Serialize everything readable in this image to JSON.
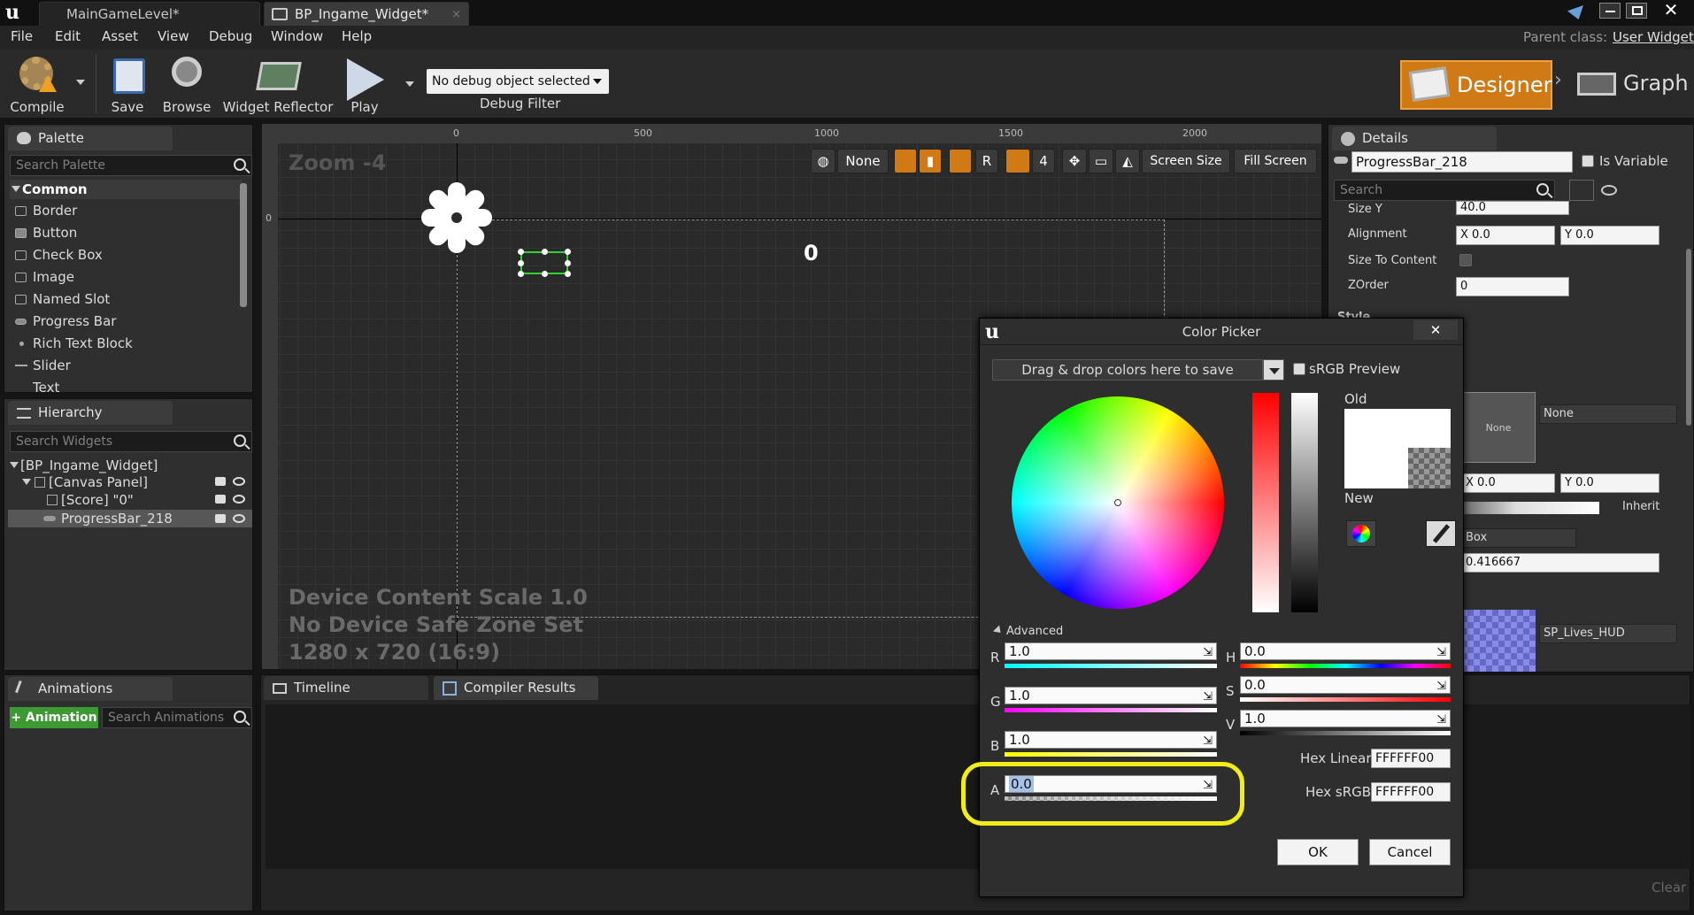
{
  "titlebar": {
    "tabs": [
      {
        "label": "MainGameLevel*"
      },
      {
        "label": "BP_Ingame_Widget*"
      }
    ]
  },
  "menubar": {
    "items": [
      "File",
      "Edit",
      "Asset",
      "View",
      "Debug",
      "Window",
      "Help"
    ],
    "parent_class_label": "Parent class:",
    "parent_class_value": "User Widget"
  },
  "toolbar": {
    "compile": "Compile",
    "save": "Save",
    "browse": "Browse",
    "widget_reflector": "Widget Reflector",
    "play": "Play",
    "debug_select": "No debug object selected",
    "debug_filter": "Debug Filter",
    "designer": "Designer",
    "graph": "Graph"
  },
  "palette": {
    "title": "Palette",
    "search_placeholder": "Search Palette",
    "category": "Common",
    "items": [
      "Border",
      "Button",
      "Check Box",
      "Image",
      "Named Slot",
      "Progress Bar",
      "Rich Text Block",
      "Slider",
      "Text"
    ]
  },
  "hierarchy": {
    "title": "Hierarchy",
    "search_placeholder": "Search Widgets",
    "root": "[BP_Ingame_Widget]",
    "canvas": "[Canvas Panel]",
    "score": "[Score] \"0\"",
    "progressbar": "ProgressBar_218"
  },
  "animations": {
    "title": "Animations",
    "add_button": "+ Animation",
    "search_placeholder": "Search Animations"
  },
  "bottom_tabs": {
    "timeline": "Timeline",
    "compiler": "Compiler Results",
    "clear": "Clear"
  },
  "viewport": {
    "zoom": "Zoom -4",
    "ruler_marks": [
      "0",
      "500",
      "1000",
      "1500",
      "2000"
    ],
    "vruler_marks": [
      "0",
      "5\n0\n0",
      "1\n0\n0\n0"
    ],
    "score_text": "0",
    "info_lines": [
      "Device Content Scale 1.0",
      "No Device Safe Zone Set",
      "1280 x 720 (16:9)"
    ],
    "buttons": {
      "none": "None",
      "r": "R",
      "four": "4",
      "screen_size": "Screen Size",
      "fill_screen": "Fill Screen"
    }
  },
  "details": {
    "title": "Details",
    "name_value": "ProgressBar_218",
    "is_variable": "Is Variable",
    "search_placeholder": "Search",
    "size_y_label": "Size Y",
    "size_y_value": "40.0",
    "alignment_label": "Alignment",
    "alignment_x": "X  0.0",
    "alignment_y": "Y  0.0",
    "size_to_content_label": "Size To Content",
    "zorder_label": "ZOrder",
    "zorder_value": "0",
    "style_label": "Style",
    "none_thumb": "None",
    "none_dropdown": "None",
    "x2": "X  0.0",
    "y2": "Y  0.0",
    "inherit": "Inherit",
    "box_dropdown": "Box",
    "fraction": "0.416667",
    "sp_lives": "SP_Lives_HUD"
  },
  "color_picker": {
    "title": "Color Picker",
    "drag_drop": "Drag & drop colors here to save",
    "srgb_preview": "sRGB Preview",
    "old": "Old",
    "new": "New",
    "advanced": "Advanced",
    "r_label": "R",
    "r_value": "1.0",
    "g_label": "G",
    "g_value": "1.0",
    "b_label": "B",
    "b_value": "1.0",
    "a_label": "A",
    "a_value": "0.0",
    "h_label": "H",
    "h_value": "0.0",
    "s_label": "S",
    "s_value": "0.0",
    "v_label": "V",
    "v_value": "1.0",
    "hex_linear_label": "Hex Linear",
    "hex_linear_value": "FFFFFF00",
    "hex_srgb_label": "Hex sRGB",
    "hex_srgb_value": "FFFFFF00",
    "ok": "OK",
    "cancel": "Cancel"
  },
  "colors": {
    "accent_orange": "#d07a16",
    "highlight_yellow": "#f2ec1a",
    "selection_green": "#2fd42f"
  }
}
